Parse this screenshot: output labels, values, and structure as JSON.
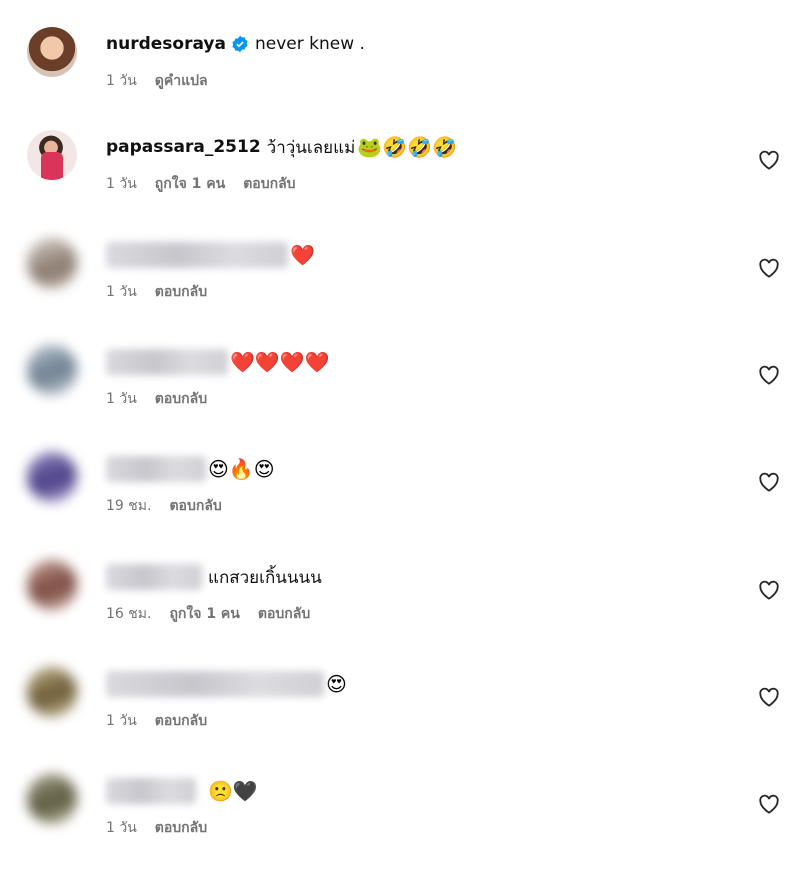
{
  "comments": [
    {
      "username": "nurdesoraya",
      "verified": true,
      "text": "never knew .",
      "emoji": "",
      "time": "1 วัน",
      "likes": "",
      "action": "ดูคำแปล",
      "has_heart": false,
      "blurred": false
    },
    {
      "username": "papassara_2512",
      "verified": false,
      "text": "ว้าวุ่นเลยแม่",
      "emoji": "🐸🤣🤣🤣",
      "time": "1 วัน",
      "likes": "ถูกใจ 1 คน",
      "action": "ตอบกลับ",
      "has_heart": true,
      "blurred": false
    },
    {
      "username": "",
      "verified": false,
      "text": "",
      "emoji": "❤️",
      "time": "1 วัน",
      "likes": "",
      "action": "ตอบกลับ",
      "has_heart": true,
      "blurred": true
    },
    {
      "username": "",
      "verified": false,
      "text": "",
      "emoji": "❤️❤️❤️❤️",
      "time": "1 วัน",
      "likes": "",
      "action": "ตอบกลับ",
      "has_heart": true,
      "blurred": true
    },
    {
      "username": "",
      "verified": false,
      "text": "",
      "emoji": "😍🔥😍",
      "time": "19 ชม.",
      "likes": "",
      "action": "ตอบกลับ",
      "has_heart": true,
      "blurred": true
    },
    {
      "username": "",
      "verified": false,
      "text": "แกสวยเกิ้นนนน",
      "emoji": "",
      "time": "16 ชม.",
      "likes": "ถูกใจ 1 คน",
      "action": "ตอบกลับ",
      "has_heart": true,
      "blurred": true
    },
    {
      "username": "",
      "verified": false,
      "text": "",
      "emoji": "😍",
      "time": "1 วัน",
      "likes": "",
      "action": "ตอบกลับ",
      "has_heart": true,
      "blurred": true
    },
    {
      "username": "",
      "verified": false,
      "text": "",
      "emoji": "🙁🖤",
      "time": "1 วัน",
      "likes": "",
      "action": "ตอบกลับ",
      "has_heart": true,
      "blurred": true
    }
  ],
  "colors": {
    "meta": "#737373",
    "verified": "#0095f6"
  },
  "icons": {
    "like": "heart-outline-icon",
    "verified": "verified-badge-icon"
  }
}
